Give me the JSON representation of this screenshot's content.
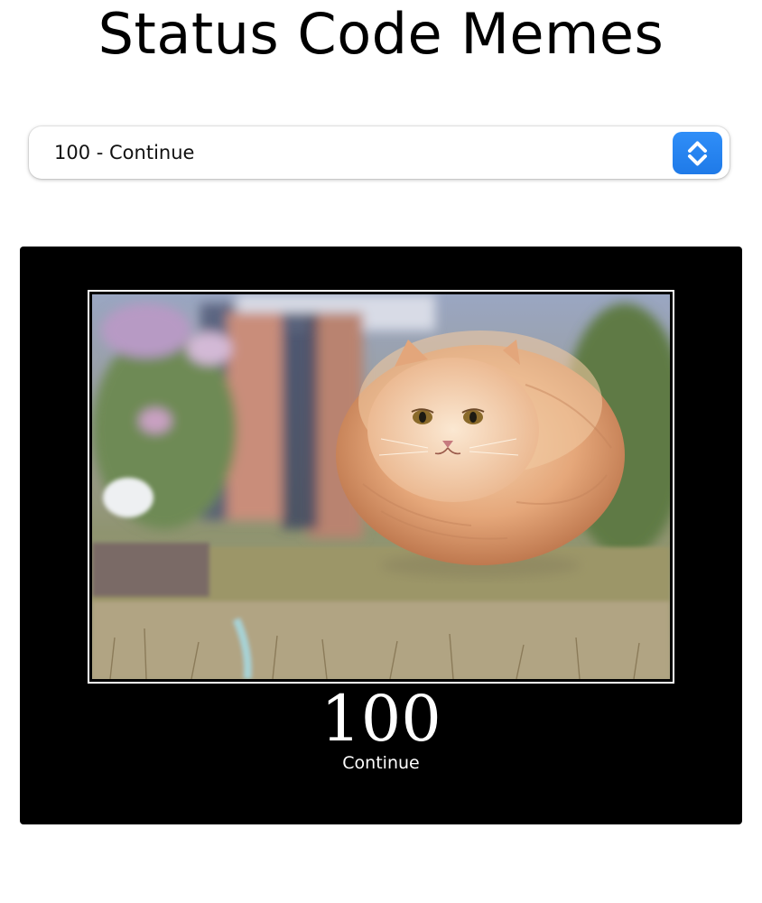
{
  "page": {
    "title": "Status Code Memes"
  },
  "status_select": {
    "selected_label": "100 - Continue",
    "button_icon": "updown-chevron-icon",
    "button_color": "#1f7ae8"
  },
  "meme": {
    "code": "100",
    "message": "Continue",
    "background_color": "#000000",
    "image_subject": "cat-photo"
  }
}
